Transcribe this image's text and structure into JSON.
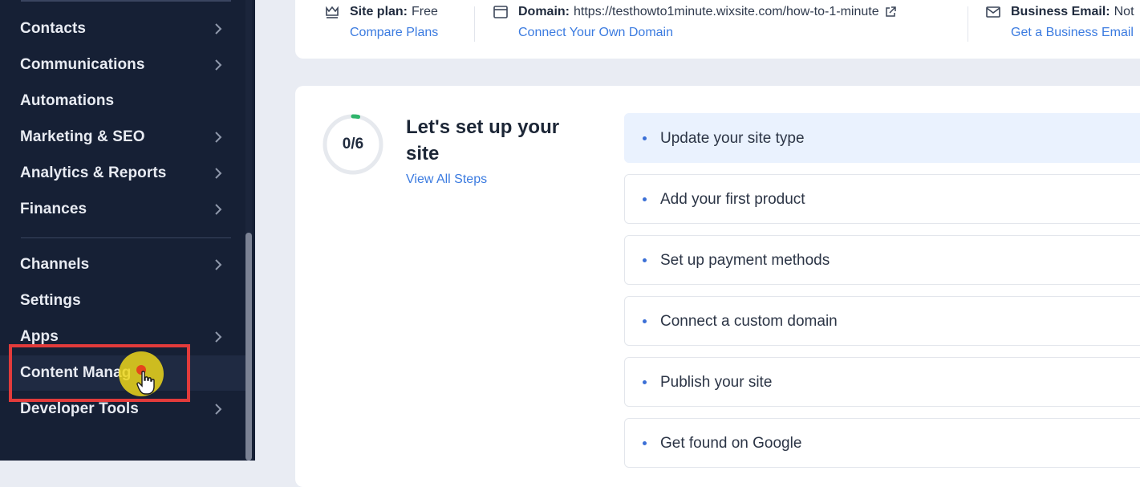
{
  "sidebar": {
    "items": [
      {
        "label": "Contacts",
        "has_chevron": true
      },
      {
        "label": "Communications",
        "has_chevron": true
      },
      {
        "label": "Automations",
        "has_chevron": false
      },
      {
        "label": "Marketing & SEO",
        "has_chevron": true
      },
      {
        "label": "Analytics & Reports",
        "has_chevron": true
      },
      {
        "label": "Finances",
        "has_chevron": true
      },
      {
        "label": "Channels",
        "has_chevron": true
      },
      {
        "label": "Settings",
        "has_chevron": false
      },
      {
        "label": "Apps",
        "has_chevron": true
      },
      {
        "label": "Content Manag",
        "has_chevron": false
      },
      {
        "label": "Developer Tools",
        "has_chevron": true
      }
    ],
    "highlight_color": "#e23b3b"
  },
  "info_bar": {
    "site_plan": {
      "label": "Site plan:",
      "value": "Free",
      "link": "Compare Plans",
      "icon": "crown-icon"
    },
    "domain": {
      "label": "Domain:",
      "value": "https://testhowto1minute.wixsite.com/how-to-1-minute",
      "link": "Connect Your Own Domain",
      "icon": "browser-icon"
    },
    "business_email": {
      "label": "Business Email:",
      "value": "Not",
      "link": "Get a Business Email",
      "icon": "mail-icon"
    }
  },
  "setup": {
    "progress_text": "0/6",
    "progress_completed": 0,
    "progress_total": 6,
    "title": "Let's set up your site",
    "view_all": "View All Steps",
    "steps": [
      {
        "label": "Update your site type"
      },
      {
        "label": "Add your first product"
      },
      {
        "label": "Set up payment methods"
      },
      {
        "label": "Connect a custom domain"
      },
      {
        "label": "Publish your site"
      },
      {
        "label": "Get found on Google"
      }
    ]
  },
  "colors": {
    "sidebar_bg": "#162035",
    "accent_link": "#3b7be0",
    "selected_step_bg": "#eaf2fe",
    "progress_accent": "#2fb56b"
  }
}
